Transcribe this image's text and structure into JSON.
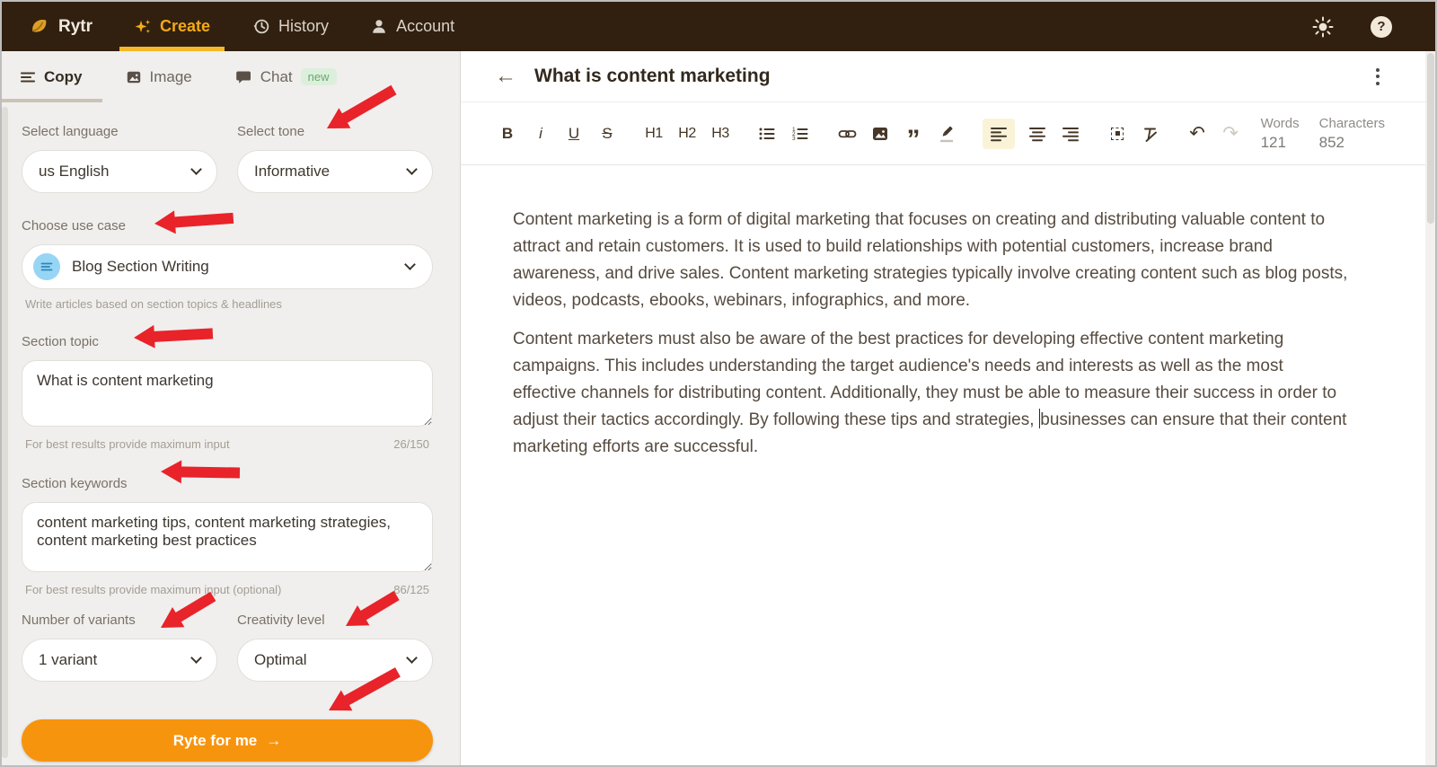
{
  "navbar": {
    "brand": "Rytr",
    "create": "Create",
    "history": "History",
    "account": "Account",
    "help_glyph": "?",
    "accent_color": "#F2A918",
    "bg_color": "#31200F"
  },
  "sidebar": {
    "tabs": {
      "copy": "Copy",
      "image": "Image",
      "chat": "Chat",
      "chat_badge": "new"
    },
    "language": {
      "label": "Select language",
      "value": "us English"
    },
    "tone": {
      "label": "Select tone",
      "value": "Informative"
    },
    "use_case": {
      "label": "Choose use case",
      "value": "Blog Section Writing",
      "helper": "Write articles based on section topics & headlines"
    },
    "topic": {
      "label": "Section topic",
      "value": "What is content marketing",
      "helper": "For best results provide maximum input",
      "counter": "26/150"
    },
    "keywords": {
      "label": "Section keywords",
      "value": "content marketing tips, content marketing strategies, content marketing best practices",
      "helper": "For best results provide maximum input (optional)",
      "counter": "86/125"
    },
    "variants": {
      "label": "Number of variants",
      "value": "1 variant"
    },
    "creativity": {
      "label": "Creativity level",
      "value": "Optimal"
    },
    "cta": {
      "label": "Ryte for me",
      "arrow_glyph": "→",
      "color": "#F7940E"
    }
  },
  "editor": {
    "back_glyph": "←",
    "title": "What is content marketing",
    "toolbar": {
      "bold": "B",
      "italic": "i",
      "underline": "U",
      "strike": "S",
      "h1": "H1",
      "h2": "H2",
      "h3": "H3",
      "quote_glyph": "”",
      "undo_glyph": "↶",
      "redo_glyph": "↷"
    },
    "stats": {
      "words_label": "Words",
      "words_value": "121",
      "chars_label": "Characters",
      "chars_value": "852"
    },
    "document": {
      "p1": "Content marketing is a form of digital marketing that focuses on creating and distributing valuable content to attract and retain customers. It is used to build relationships with potential customers, increase brand awareness, and drive sales. Content marketing strategies typically involve creating content such as blog posts, videos, podcasts, ebooks, webinars, infographics, and more.",
      "p2_before_caret": "Content marketers must also be aware of the best practices for developing effective content marketing campaigns. This includes understanding the target audience's needs and interests as well as the most effective channels for distributing content. Additionally, they must be able to measure their success in order to adjust their tactics accordingly. By following these tips and strategies, ",
      "p2_after_caret": "businesses can ensure that their content marketing efforts are successful."
    }
  },
  "annotations": {
    "arrow_color": "#E8232A",
    "count": 7
  }
}
